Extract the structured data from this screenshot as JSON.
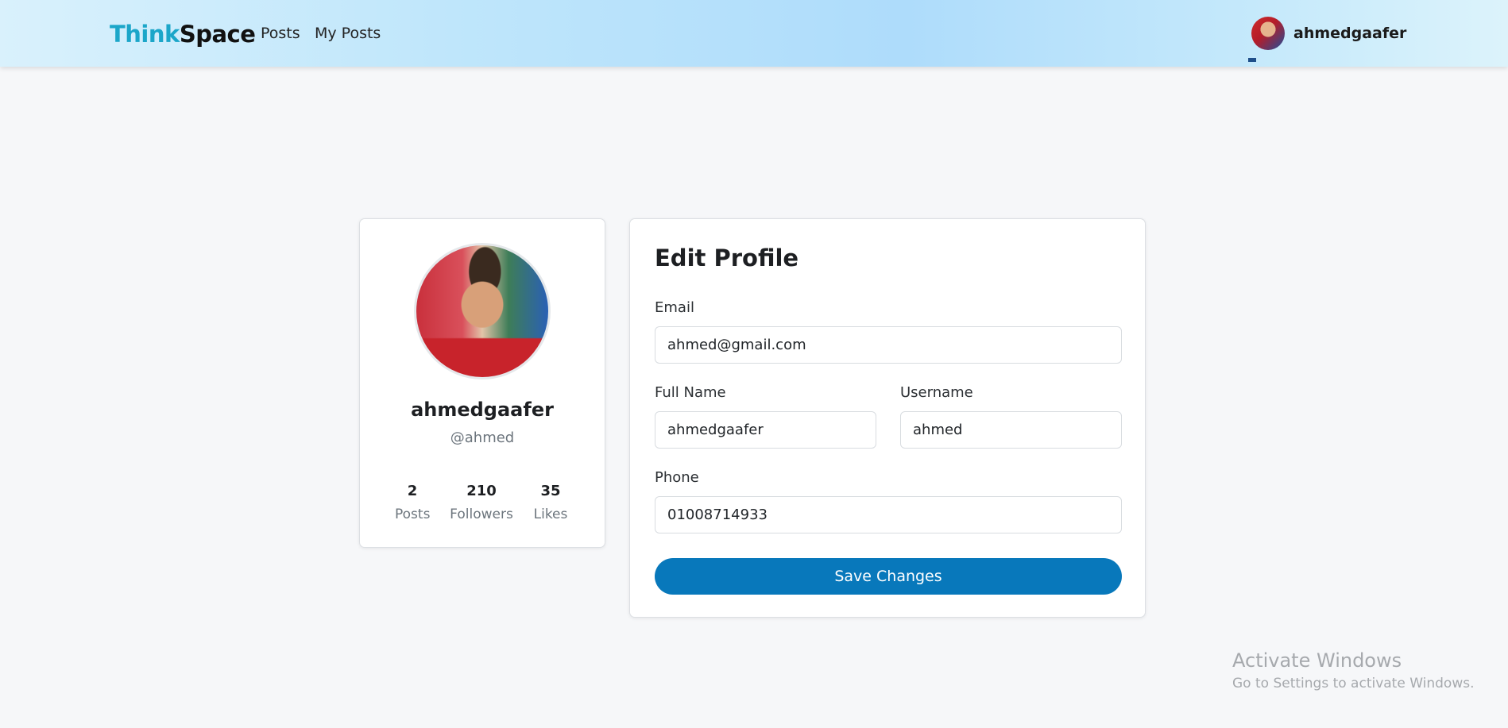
{
  "navbar": {
    "brand_part1": "Think",
    "brand_part2": "Space",
    "links": [
      {
        "label": "Posts"
      },
      {
        "label": "My Posts"
      }
    ],
    "user": {
      "username": "ahmedgaafer",
      "avatar_icon": "user-avatar"
    }
  },
  "profile": {
    "name": "ahmedgaafer",
    "handle": "@ahmed",
    "stats": [
      {
        "value": "2",
        "label": "Posts"
      },
      {
        "value": "210",
        "label": "Followers"
      },
      {
        "value": "35",
        "label": "Likes"
      }
    ]
  },
  "edit_form": {
    "title": "Edit Profile",
    "email": {
      "label": "Email",
      "value": "ahmed@gmail.com"
    },
    "full_name": {
      "label": "Full Name",
      "value": "ahmedgaafer"
    },
    "username": {
      "label": "Username",
      "value": "ahmed"
    },
    "phone": {
      "label": "Phone",
      "value": "01008714933"
    },
    "save_label": "Save Changes"
  },
  "watermark": {
    "title": "Activate Windows",
    "subtitle": "Go to Settings to activate Windows."
  },
  "colors": {
    "brand_accent": "#1ba6c9",
    "primary_button": "#0878bb",
    "page_background": "#f6f7f9"
  }
}
